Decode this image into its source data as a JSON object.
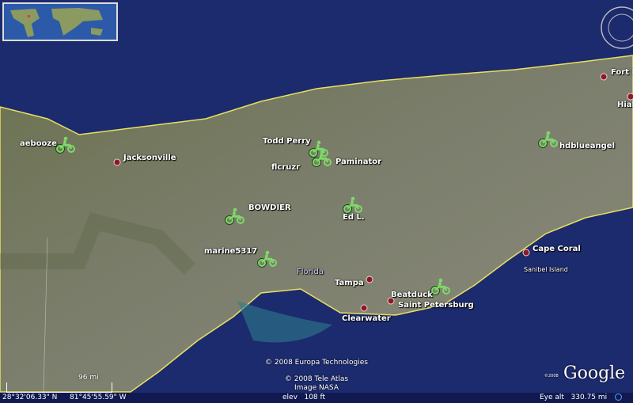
{
  "riders": [
    "aebooze",
    "Todd Perry",
    "flcruzr",
    "Paminator",
    "BOWDIER",
    "Ed L.",
    "marine5317",
    "Beatduck",
    "hdblueangel"
  ],
  "cities": [
    "Jacksonville",
    "Tampa",
    "Saint Petersburg",
    "Clearwater",
    "Cape Coral",
    "Fort L",
    "Hial"
  ],
  "region_labels": {
    "state": "Florida",
    "island": "Sanibel Island"
  },
  "scale": "96 mi",
  "copyright": {
    "europa": "© 2008 Europa Technologies",
    "teleatlas": "© 2008 Tele Atlas",
    "nasa": "Image NASA",
    "google_year": "©2008",
    "google": "Google"
  },
  "status": {
    "lat": "28°32'06.33\" N",
    "lon": "81°45'55.59\" W",
    "elev": "elev   108 ft",
    "eye": "Eye alt   330.75 mi"
  },
  "colors": {
    "ocean": "#1c2a6e",
    "rider": "#7fd86a",
    "coast": "#e8e060"
  }
}
